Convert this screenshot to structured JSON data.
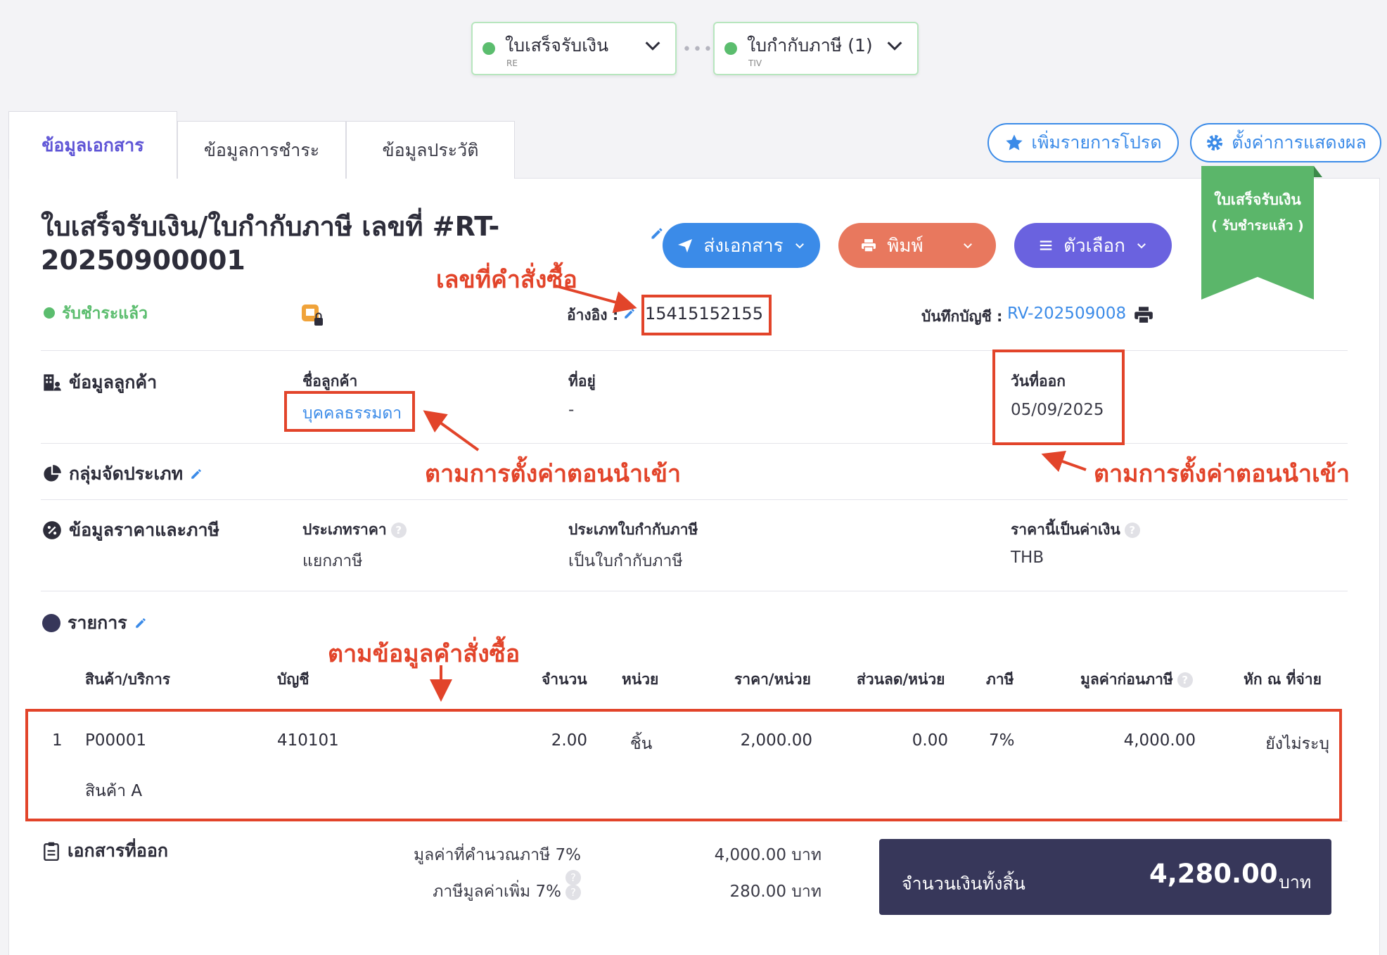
{
  "flow": {
    "receipt": {
      "title": "ใบเสร็จรับเงิน",
      "code": "RE"
    },
    "tax_invoice": {
      "title": "ใบกำกับภาษี (1)",
      "code": "TIV"
    }
  },
  "tabs": [
    "ข้อมูลเอกสาร",
    "ข้อมูลการชำระ",
    "ข้อมูลประวัติ"
  ],
  "top_buttons": {
    "favorite": "เพิ่มรายการโปรด",
    "display_settings": "ตั้งค่าการแสดงผล"
  },
  "ribbon": {
    "line1": "ใบเสร็จรับเงิน",
    "line2": "( รับชำระแล้ว )"
  },
  "document": {
    "title": "ใบเสร็จรับเงิน/ใบกำกับภาษี เลขที่ #RT-20250900001",
    "status": "รับชำระแล้ว",
    "reference_label": "อ้างอิง :",
    "reference_value": "15415152155",
    "journal_label": "บันทึกบัญชี :",
    "journal_value": "RV-202509008"
  },
  "actions": {
    "send": "ส่งเอกสาร",
    "print": "พิมพ์",
    "options": "ตัวเลือก"
  },
  "customer": {
    "section": "ข้อมูลลูกค้า",
    "name_label": "ชื่อลูกค้า",
    "name_value": "บุคคลธรรมดา",
    "address_label": "ที่อยู่",
    "address_value": "-",
    "date_label": "วันที่ออก",
    "date_value": "05/09/2025"
  },
  "classification": {
    "section": "กลุ่มจัดประเภท"
  },
  "pricing": {
    "section": "ข้อมูลราคาและภาษี",
    "price_type_label": "ประเภทราคา",
    "price_type_value": "แยกภาษี",
    "tax_invoice_type_label": "ประเภทใบกำกับภาษี",
    "tax_invoice_type_value": "เป็นใบกำกับภาษี",
    "currency_label": "ราคานี้เป็นค่าเงิน",
    "currency_value": "THB"
  },
  "items": {
    "section": "รายการ",
    "headers": [
      "สินค้า/บริการ",
      "บัญชี",
      "จำนวน",
      "หน่วย",
      "ราคา/หน่วย",
      "ส่วนลด/หน่วย",
      "ภาษี",
      "มูลค่าก่อนภาษี",
      "หัก ณ ที่จ่าย"
    ],
    "rows": [
      {
        "no": "1",
        "code": "P00001",
        "name": "สินค้า A",
        "account": "410101",
        "qty": "2.00",
        "unit": "ชิ้น",
        "price": "2,000.00",
        "discount": "0.00",
        "tax": "7%",
        "amount": "4,000.00",
        "wht": "ยังไม่ระบุ"
      }
    ]
  },
  "summary": {
    "section": "เอกสารที่ออก",
    "taxable_label": "มูลค่าที่คำนวณภาษี 7%",
    "taxable_value": "4,000.00 บาท",
    "vat_label": "ภาษีมูลค่าเพิ่ม 7%",
    "vat_value": "280.00 บาท",
    "total_label": "จำนวนเงินทั้งสิ้น",
    "total_value": "4,280.00",
    "total_unit": "บาท"
  },
  "annotations": {
    "order_number": "เลขที่คำสั่งซื้อ",
    "import_setting_1": "ตามการตั้งค่าตอนนำเข้า",
    "import_setting_2": "ตามการตั้งค่าตอนนำเข้า",
    "order_data": "ตามข้อมูลคำสั่งซื้อ"
  },
  "colors": {
    "accent": "#5f55d6",
    "link": "#3b8be8",
    "success": "#5bbd6e",
    "annotation": "#e2442a",
    "total_bg": "#37375a"
  }
}
